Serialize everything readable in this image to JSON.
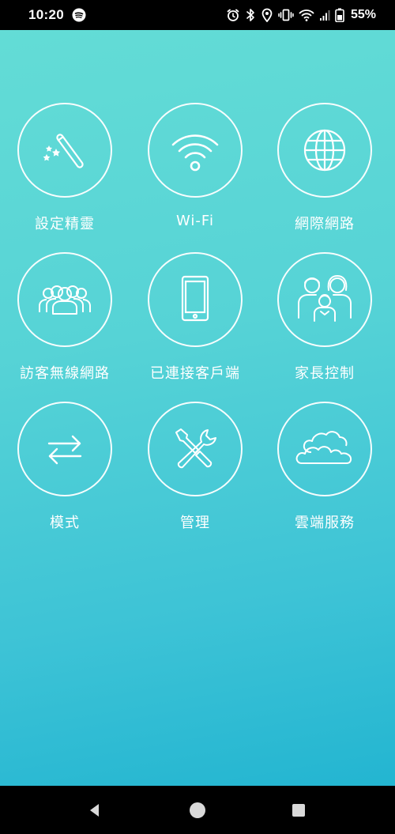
{
  "status_bar": {
    "time": "10:20",
    "battery": "55%",
    "left_icons": [
      "spotify-icon"
    ],
    "right_icons": [
      "alarm-icon",
      "bluetooth-icon",
      "location-icon",
      "vibrate-icon",
      "wifi-icon",
      "signal-icon",
      "battery-icon"
    ]
  },
  "menu": {
    "items": [
      {
        "label": "設定精靈",
        "icon": "magic-wand-icon"
      },
      {
        "label": "Wi-Fi",
        "icon": "wifi-icon"
      },
      {
        "label": "網際網路",
        "icon": "globe-icon"
      },
      {
        "label": "訪客無線網路",
        "icon": "guests-icon"
      },
      {
        "label": "已連接客戶端",
        "icon": "tablet-icon"
      },
      {
        "label": "家長控制",
        "icon": "family-icon"
      },
      {
        "label": "模式",
        "icon": "swap-arrows-icon"
      },
      {
        "label": "管理",
        "icon": "tools-icon"
      },
      {
        "label": "雲端服務",
        "icon": "cloud-icon"
      }
    ]
  },
  "nav_bar": {
    "buttons": [
      "back-icon",
      "home-icon",
      "recents-icon"
    ]
  },
  "colors": {
    "background_top": "#63dcd6",
    "background_bottom": "#23b5d1",
    "foreground": "#ffffff"
  }
}
